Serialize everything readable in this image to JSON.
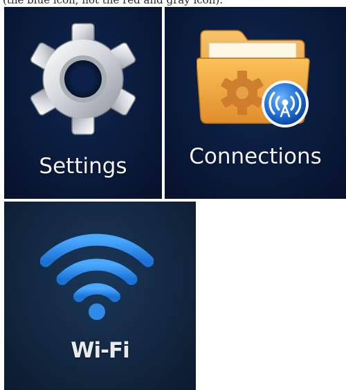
{
  "caption": "(the blue icon, not the red and gray icon).",
  "tiles": {
    "settings": {
      "label": "Settings",
      "icon": "gear-icon"
    },
    "connections": {
      "label": "Connections",
      "icon": "folder-broadcast-icon"
    },
    "wifi": {
      "label": "Wi-Fi",
      "icon": "wifi-icon"
    }
  },
  "colors": {
    "tile_background": "#0a1a3a",
    "wifi_blue": "#2f8be6",
    "folder_orange": "#f0a640",
    "badge_blue": "#1f6fd8"
  }
}
